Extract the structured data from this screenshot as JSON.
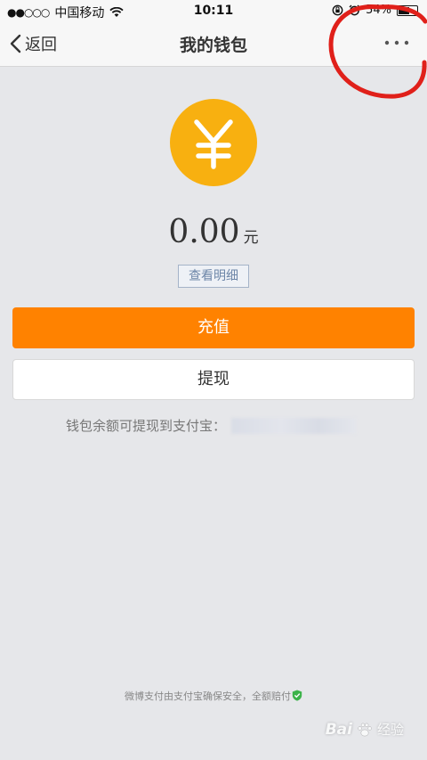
{
  "status_bar": {
    "signal": "●●○○○",
    "carrier": "中国移动",
    "time": "10:11",
    "battery": "54%"
  },
  "nav": {
    "back_label": "返回",
    "title": "我的钱包",
    "more_icon": "more-dots-icon"
  },
  "wallet": {
    "coin_symbol": "¥",
    "coin_color": "#f8b010",
    "balance": "0.00",
    "unit": "元",
    "details_link": "查看明细",
    "recharge_label": "充值",
    "recharge_color": "#ff8200",
    "withdraw_label": "提现",
    "alipay_note": "钱包余额可提现到支付宝："
  },
  "footer": {
    "note": "微博支付由支付宝确保安全，全额赔付"
  },
  "watermark": {
    "brand": "Bai",
    "suffix": "经验"
  },
  "annotation": {
    "color": "#e0201a"
  }
}
